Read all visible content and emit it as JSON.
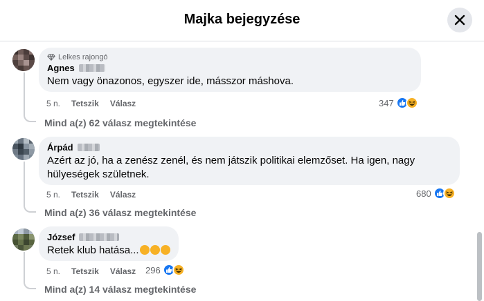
{
  "header": {
    "title": "Majka bejegyzése"
  },
  "colors": {
    "like": "#1877f2",
    "haha": "#f7b125",
    "muted": "#65676b",
    "bubble": "#f0f2f5"
  },
  "comments": [
    {
      "badge": "Lelkes rajongó",
      "author": "Agnes",
      "text": "Nem vagy önazonos, egyszer ide, másszor máshova.",
      "time": "5 n.",
      "like_label": "Tetszik",
      "reply_label": "Válasz",
      "reaction_count": "347",
      "view_replies": "Mind a(z) 62 válasz megtekintése"
    },
    {
      "author": "Árpád",
      "text_line1": "Azért az jó, ha a zenész zenél, és nem játszik politikai elemzőset. Ha igen, nagy",
      "text_line2": "hülyeségek születnek.",
      "time": "5 n.",
      "like_label": "Tetszik",
      "reply_label": "Válasz",
      "reaction_count": "680",
      "view_replies": "Mind a(z) 36 válasz megtekintése"
    },
    {
      "author": "József",
      "text": "Retek klub hatása...",
      "text_emojis": [
        "rolling-on-floor-laughing",
        "rolling-on-floor-laughing",
        "rolling-on-floor-laughing"
      ],
      "time": "5 n.",
      "like_label": "Tetszik",
      "reply_label": "Válasz",
      "reaction_count": "296",
      "view_replies": "Mind a(z) 14 válasz megtekintése"
    }
  ]
}
